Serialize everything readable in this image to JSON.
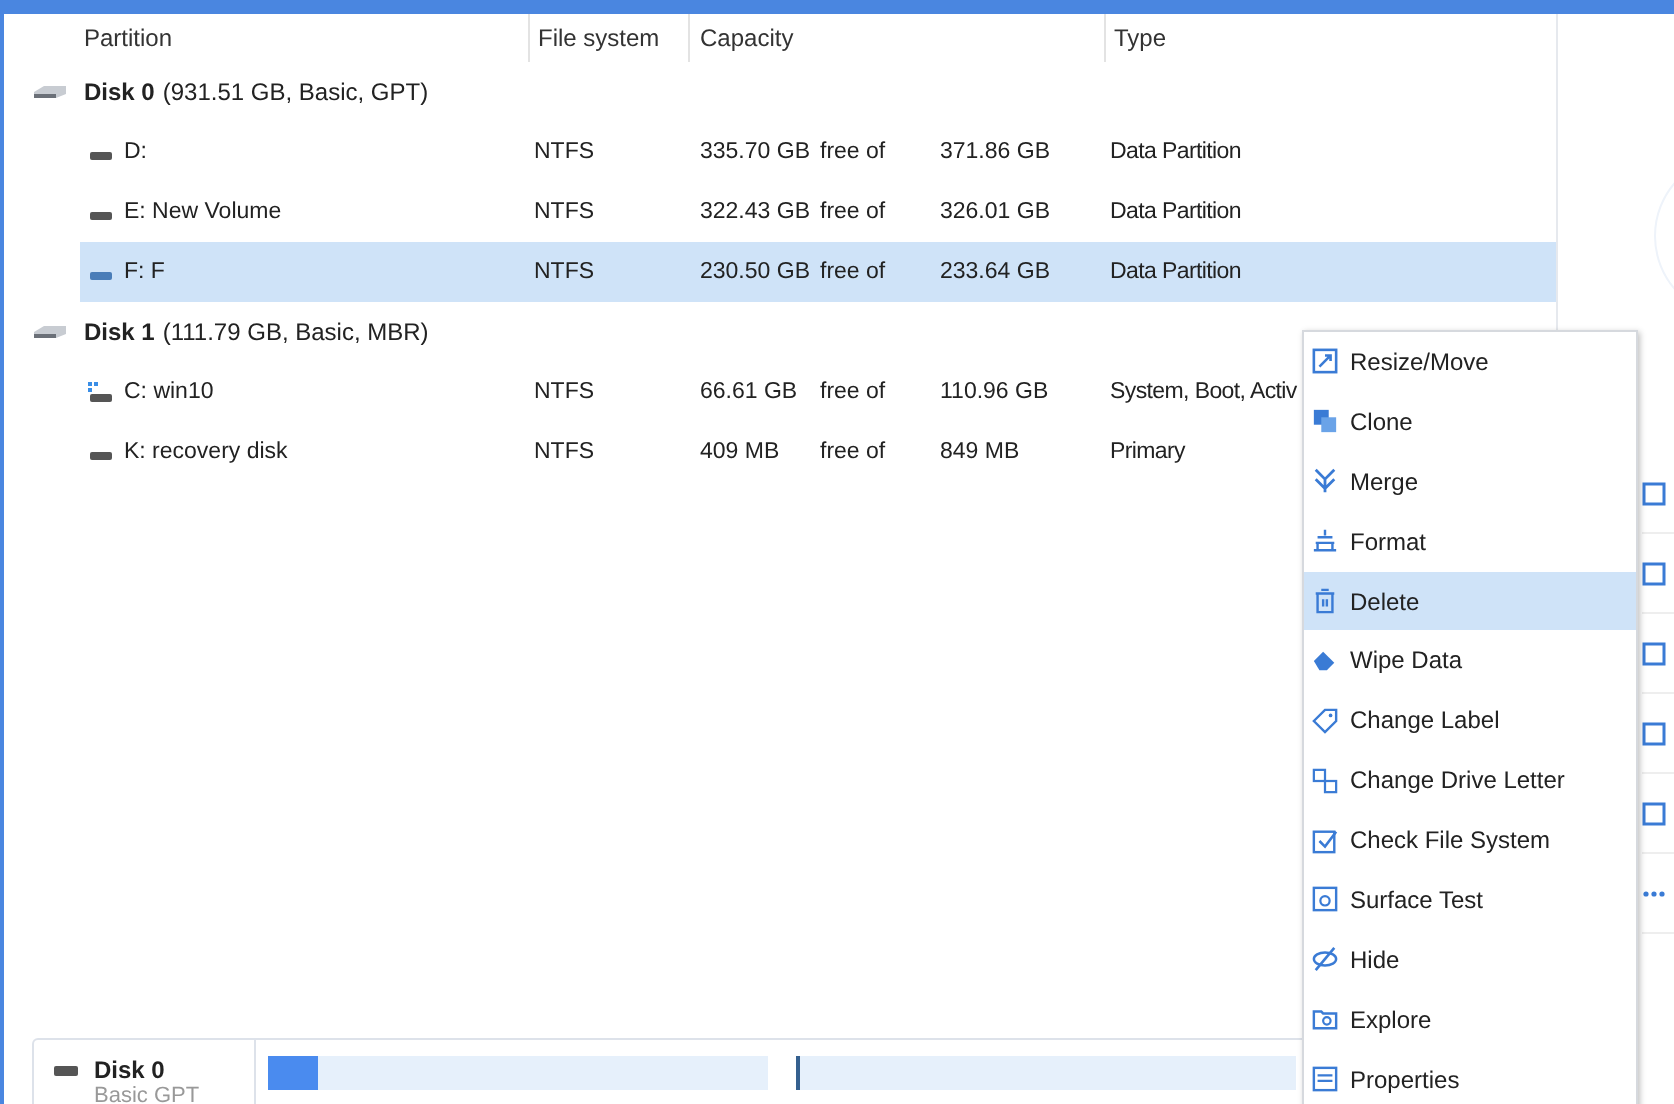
{
  "table": {
    "columns": [
      "Partition",
      "File system",
      "Capacity",
      "Type"
    ],
    "disks": [
      {
        "name": "Disk 0",
        "details": "(931.51 GB, Basic, GPT)",
        "partitions": [
          {
            "kind": "data",
            "name": "D:",
            "file_system": "NTFS",
            "free": "335.70 GB",
            "free_of": "free of",
            "total": "371.86 GB",
            "type": "Data Partition",
            "selected": false
          },
          {
            "kind": "data",
            "name": "E: New Volume",
            "file_system": "NTFS",
            "free": "322.43 GB",
            "free_of": "free of",
            "total": "326.01 GB",
            "type": "Data Partition",
            "selected": false
          },
          {
            "kind": "data",
            "name": "F: F",
            "file_system": "NTFS",
            "free": "230.50 GB",
            "free_of": "free of",
            "total": "233.64 GB",
            "type": "Data Partition",
            "selected": true
          }
        ]
      },
      {
        "name": "Disk 1",
        "details": "(111.79 GB, Basic, MBR)",
        "partitions": [
          {
            "kind": "system",
            "name": "C: win10",
            "file_system": "NTFS",
            "free": "66.61 GB",
            "free_of": "free of",
            "total": "110.96 GB",
            "type": "System, Boot, Activ",
            "selected": false
          },
          {
            "kind": "data",
            "name": "K: recovery disk",
            "file_system": "NTFS",
            "free": "409 MB",
            "free_of": "free of",
            "total": "849 MB",
            "type": "Primary",
            "selected": false
          }
        ]
      }
    ]
  },
  "context_menu": [
    {
      "label": "Resize/Move",
      "selected": false
    },
    {
      "label": "Clone",
      "selected": false
    },
    {
      "label": "Merge",
      "selected": false
    },
    {
      "label": "Format",
      "selected": false
    },
    {
      "label": "Delete",
      "selected": true
    },
    {
      "label": "Wipe Data",
      "selected": false
    },
    {
      "label": "Change Label",
      "selected": false
    },
    {
      "label": "Change Drive Letter",
      "selected": false
    },
    {
      "label": "Check File System",
      "selected": false
    },
    {
      "label": "Surface Test",
      "selected": false
    },
    {
      "label": "Hide",
      "selected": false
    },
    {
      "label": "Explore",
      "selected": false
    },
    {
      "label": "Properties",
      "selected": false
    }
  ],
  "disk_map": {
    "name": "Disk 0",
    "details": "Basic GPT",
    "segments": [
      {
        "level": 0.1
      },
      {
        "level": 0.005
      }
    ]
  }
}
